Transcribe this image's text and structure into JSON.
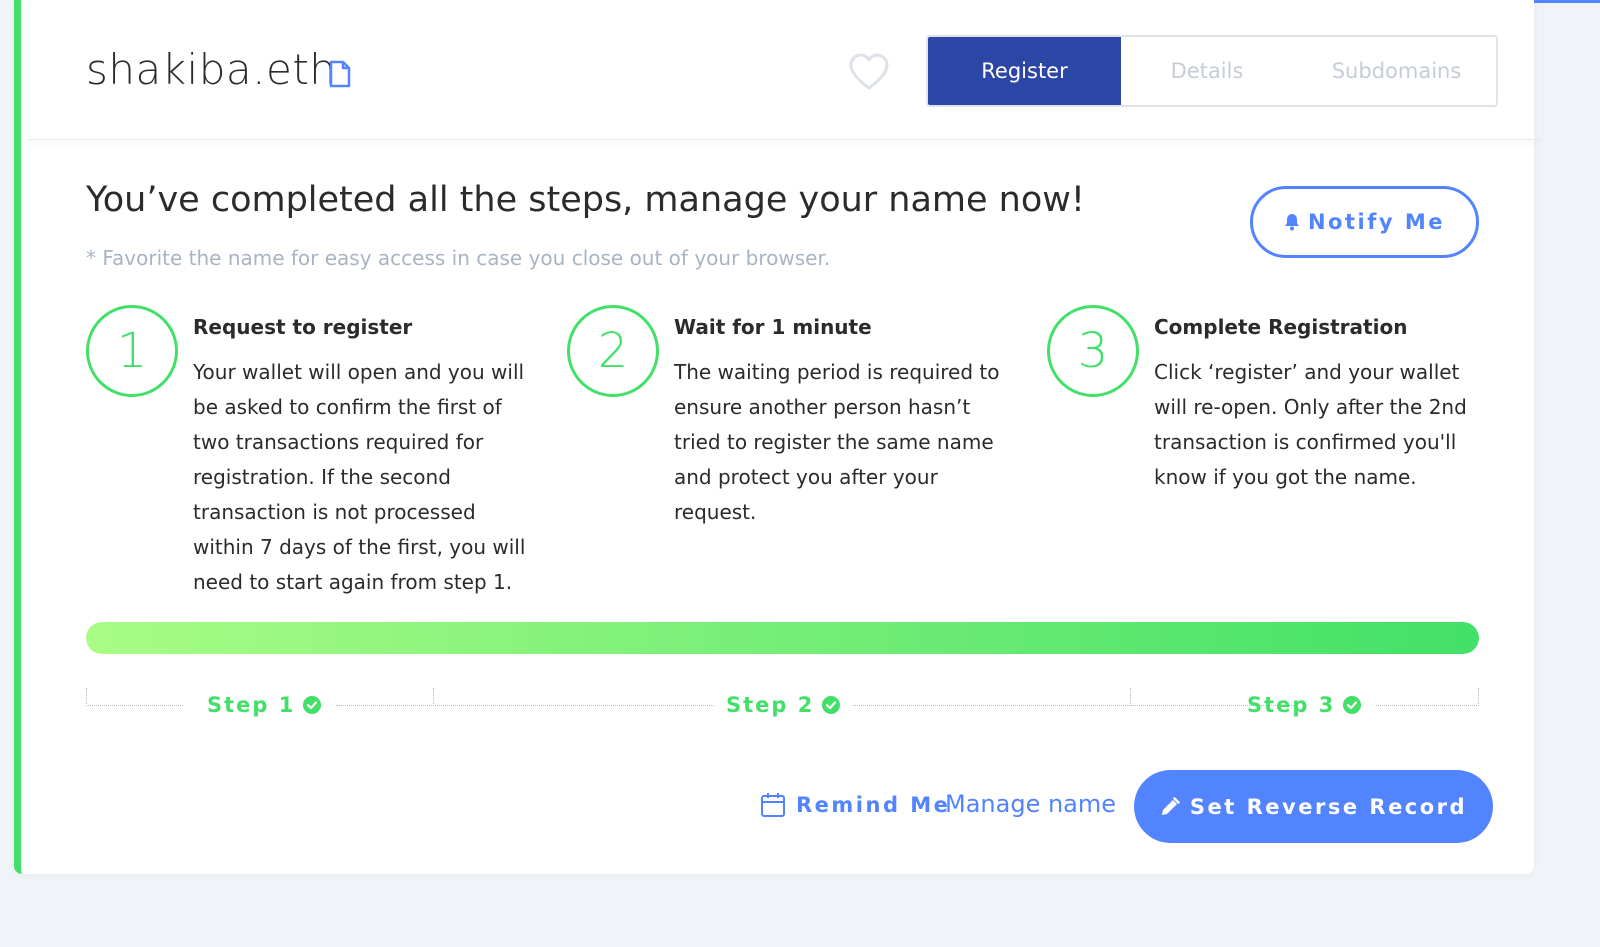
{
  "header": {
    "domain": "shakiba.eth",
    "tabs": [
      {
        "label": "Register",
        "active": true
      },
      {
        "label": "Details",
        "active": false
      },
      {
        "label": "Subdomains",
        "active": false
      }
    ]
  },
  "main": {
    "headline": "You’ve completed all the steps, manage your name now!",
    "note": "* Favorite the name for easy access in case you close out of your browser.",
    "notify_label": "Notify Me",
    "steps": [
      {
        "number": "1",
        "title": "Request to register",
        "text": "Your wallet will open and you will be asked to confirm the first of two transactions required for registration. If the second transaction is not processed within 7 days of the first, you will need to start again from step 1."
      },
      {
        "number": "2",
        "title": "Wait for 1 minute",
        "text": "The waiting period is required to ensure another person hasn’t tried to register the same name and protect you after your request."
      },
      {
        "number": "3",
        "title": "Complete Registration",
        "text": "Click ‘register’ and your wallet will re-open. Only after the 2nd transaction is confirmed you'll know if you got the name."
      }
    ],
    "progress_percent": 100,
    "step_labels": [
      "Step 1",
      "Step 2",
      "Step 3"
    ]
  },
  "actions": {
    "remind_label": "Remind Me",
    "manage_label": "Manage name",
    "reverse_label": "Set Reverse Record"
  },
  "colors": {
    "accent_green": "#42e068",
    "accent_blue": "#5284ff",
    "tab_active": "#2c46a6"
  }
}
